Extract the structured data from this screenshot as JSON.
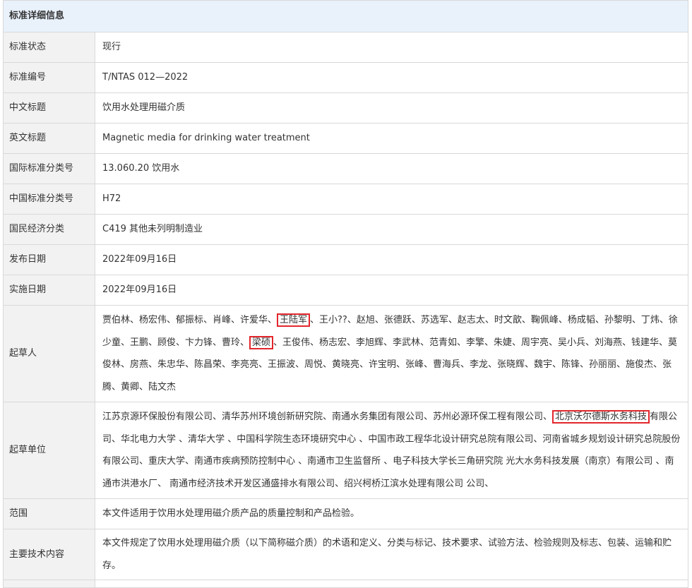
{
  "section_title": "标准详细信息",
  "rows": [
    {
      "label": "标准状态",
      "value": "现行"
    },
    {
      "label": "标准编号",
      "value": "T/NTAS 012—2022"
    },
    {
      "label": "中文标题",
      "value": "饮用水处理用磁介质"
    },
    {
      "label": "英文标题",
      "value": "Magnetic media for drinking water treatment"
    },
    {
      "label": "国际标准分类号",
      "value": "13.060.20 饮用水"
    },
    {
      "label": "中国标准分类号",
      "value": "H72"
    },
    {
      "label": "国民经济分类",
      "value": "C419 其他未列明制造业"
    },
    {
      "label": "发布日期",
      "value": "2022年09月16日"
    },
    {
      "label": "实施日期",
      "value": "2022年09月16日"
    }
  ],
  "drafters": {
    "label": "起草人",
    "part1": "贾伯林、杨宏伟、郁振标、肖峰、许爱华、",
    "highlight1": "王陆军",
    "part2": "、王小??、赵旭、张德跃、苏选军、赵志太、时文歆、鞠佩峰、杨成韬、孙黎明、丁炜、徐少童、王鹏、顾俊、卞力锋、曹玲、",
    "highlight2": "梁硕",
    "part3": "、王俊伟、杨志宏、李旭辉、李武林、范青如、李擎、朱婕、周宇亮、吴小兵、刘海燕、钱建华、莫俊林、房燕、朱忠华、陈昌荣、李亮亮、王振波、周悦、黄晓亮、许宝明、张峰、曹海兵、李龙、张晓辉、魏宇、陈锋、孙丽丽、施俊杰、张腾、黄卿、陆文杰"
  },
  "drafting_units": {
    "label": "起草单位",
    "part1": "江苏京源环保股份有限公司、清华苏州环境创新研究院、南通水务集团有限公司、苏州必源环保工程有限公司、",
    "highlight": "北京沃尔德斯水务科技",
    "part2": "有限公司、华北电力大学 、清华大学 、中国科学院生态环境研究中心 、中国市政工程华北设计研究总院有限公司、河南省城乡规划设计研究总院股份有限公司、重庆大学、南通市疾病预防控制中心 、南通市卫生监督所 、电子科技大学长三角研究院 光大水务科技发展（南京）有限公司 、南通市洪港水厂、 南通市经济技术开发区通盛排水有限公司、绍兴柯桥江滨水处理有限公司 公司、"
  },
  "scope": {
    "label": "范围",
    "value": "本文件适用于饮用水处理用磁介质产品的质量控制和产品检验。"
  },
  "main_tech": {
    "label": "主要技术内容",
    "value": "本文件规定了饮用水处理用磁介质（以下简称磁介质）的术语和定义、分类与标记、技术要求、试验方法、检验规则及标志、包装、运输和贮存。"
  },
  "colors": {
    "header_bg": "#e9f1fb",
    "label_bg": "#f2f2f2",
    "border": "#d9d9d9",
    "highlight": "#e2262b"
  }
}
